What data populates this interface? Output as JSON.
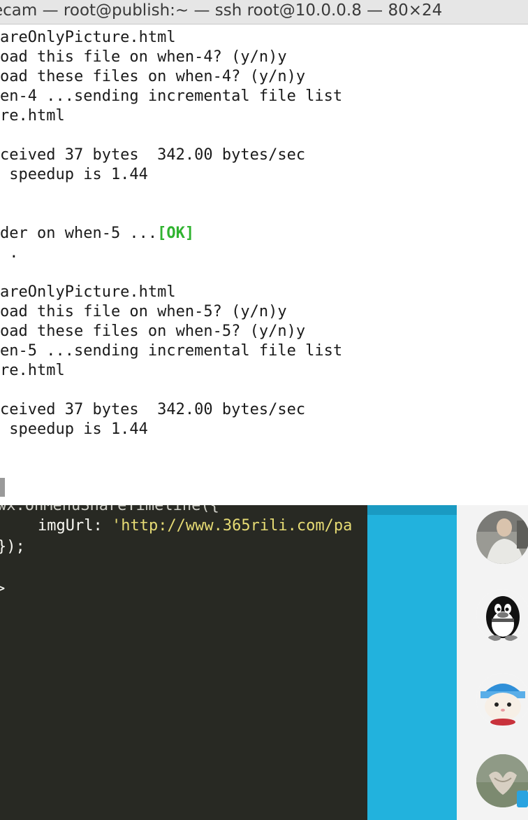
{
  "window": {
    "title": "ecam — root@publish:~ — ssh root@10.0.0.8 — 80×24"
  },
  "terminal": {
    "lines": [
      "areOnlyPicture.html",
      "oad this file on when-4? (y/n)y",
      "oad these files on when-4? (y/n)y",
      "en-4 ...sending incremental file list",
      "re.html",
      "",
      "ceived 37 bytes  342.00 bytes/sec",
      " speedup is 1.44",
      "",
      "",
      "der on when-5 ...",
      " .",
      "",
      "areOnlyPicture.html",
      "oad this file on when-5? (y/n)y",
      "oad these files on when-5? (y/n)y",
      "en-5 ...sending incremental file list",
      "re.html",
      "",
      "ceived 37 bytes  342.00 bytes/sec",
      " speedup is 1.44"
    ],
    "ok_badge": "[OK]"
  },
  "editor": {
    "cut_line": "wx.onMenuShareTimeline({",
    "img_key": "imgUrl: ",
    "img_value": "'http://www.365rili.com/pa",
    "close_line": "});",
    "tag_line": ">"
  },
  "colors": {
    "ok_green": "#2fb32f",
    "editor_bg": "#282923",
    "accent_blue": "#22b2dd",
    "string_yellow": "#e6db74"
  },
  "contacts": {
    "avatars": [
      "person-photo-avatar",
      "penguin-avatar",
      "cat-avatar",
      "hands-photo-avatar"
    ]
  }
}
